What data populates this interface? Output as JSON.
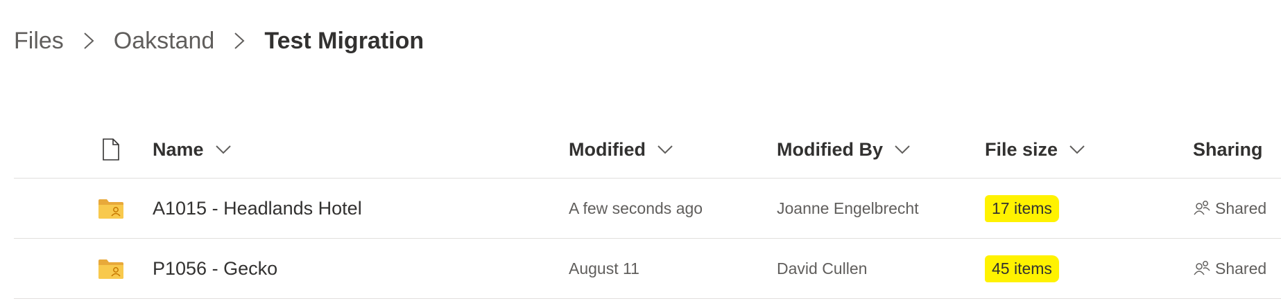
{
  "breadcrumb": {
    "items": [
      "Files",
      "Oakstand"
    ],
    "current": "Test Migration"
  },
  "columns": {
    "type_icon": "file-icon",
    "name": "Name",
    "modified": "Modified",
    "modified_by": "Modified By",
    "file_size": "File size",
    "sharing": "Sharing"
  },
  "rows": [
    {
      "icon": "shared-folder-icon",
      "name": "A1015 - Headlands Hotel",
      "modified": "A few seconds ago",
      "modified_by": "Joanne Engelbrecht",
      "file_size": "17 items",
      "sharing": "Shared"
    },
    {
      "icon": "shared-folder-icon",
      "name": "P1056 - Gecko",
      "modified": "August 11",
      "modified_by": "David Cullen",
      "file_size": "45 items",
      "sharing": "Shared"
    }
  ],
  "colors": {
    "highlight": "#fff200",
    "folder": "#f8c94d",
    "folder_dark": "#e8a93a",
    "text_primary": "#323130",
    "text_secondary": "#605e5c",
    "divider": "#e1dfdd"
  }
}
